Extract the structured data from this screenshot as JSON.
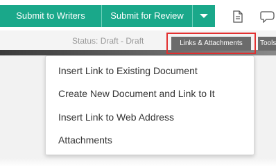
{
  "toolbar": {
    "submit_writers_label": "Submit to Writers",
    "submit_review_label": "Submit for Review",
    "accent_color": "#1aa88a"
  },
  "icons": {
    "dropdown": "chevron-down-icon",
    "document": "document-icon",
    "comment": "comment-icon"
  },
  "status": {
    "text": "Status: Draft - Draft"
  },
  "tabs": {
    "links_attachments": "Links & Attachments",
    "tools": "Tools"
  },
  "highlight_color": "#e23030",
  "menu": {
    "items": [
      "Insert Link to Existing Document",
      "Create New Document and Link to It",
      "Insert Link to Web Address",
      "Attachments"
    ]
  }
}
